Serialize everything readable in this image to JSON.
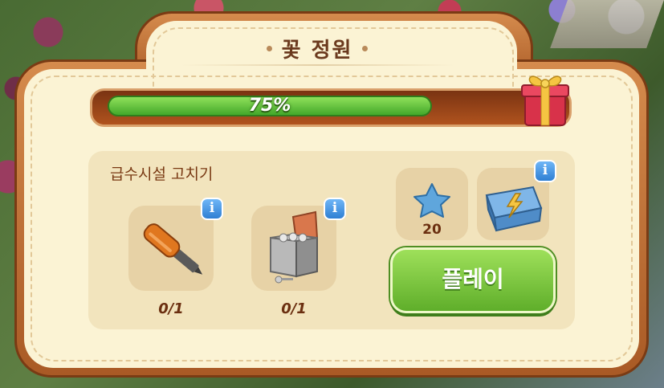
{
  "panel": {
    "title": "꽃 정원",
    "progress_percent": 75,
    "progress_label": "75%"
  },
  "task": {
    "title": "급수시설 고치기",
    "items": [
      {
        "icon": "screwdriver-icon",
        "progress": "0/1"
      },
      {
        "icon": "nuts-bolts-box-icon",
        "progress": "0/1"
      }
    ]
  },
  "rewards": {
    "star_icon": "blue-star-icon",
    "star_count": "20",
    "chest_icon": "power-up-chest-icon"
  },
  "play_button": {
    "label": "플레이"
  },
  "colors": {
    "accent_green": "#5fae2a",
    "frame_brown": "#a95a25",
    "panel_cream": "#fbf3d4"
  }
}
